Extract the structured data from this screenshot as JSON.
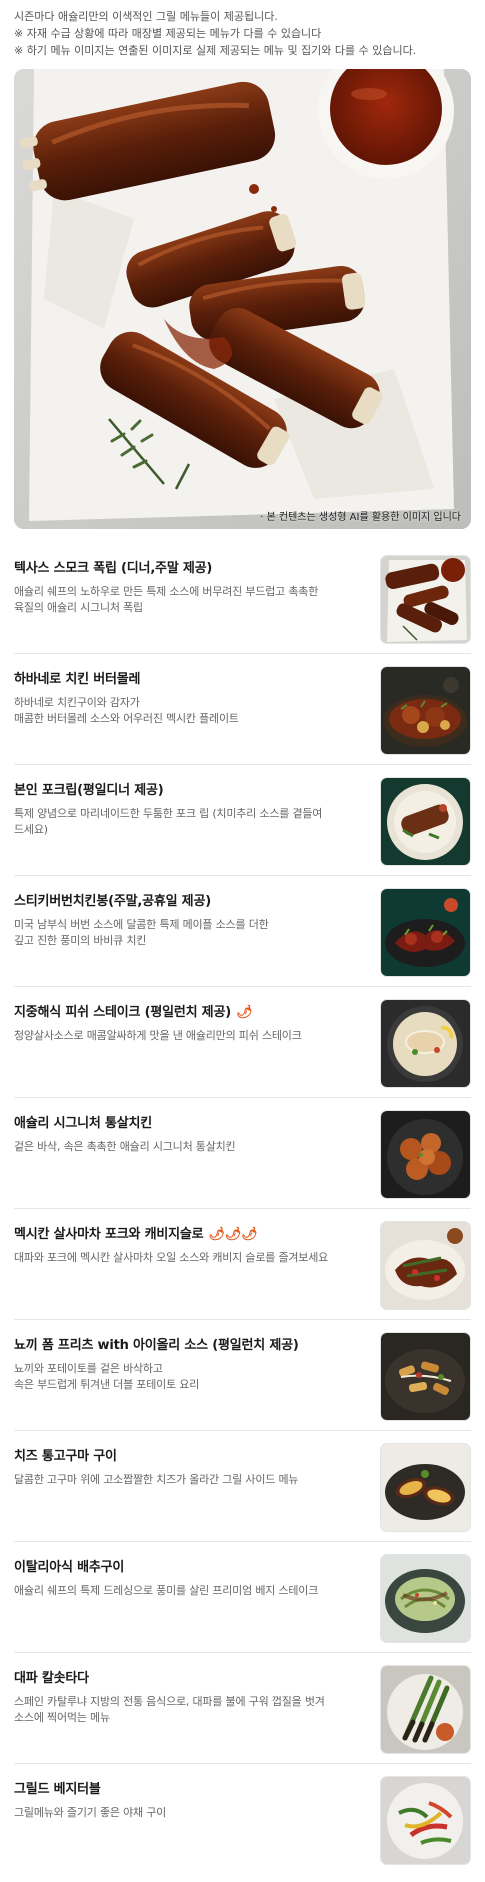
{
  "notices": [
    "시즌마다 애슐리만의 이색적인 그릴 메뉴들이 제공됩니다.",
    "※ 자재 수급 상황에 따라 매장별 제공되는 메뉴가 다를 수 있습니다",
    "※ 하기 메뉴 이미지는 연출된 이미지로 실제 제공되는 메뉴 및 집기와 다를 수 있습니다."
  ],
  "hero": {
    "caption": "· 본 컨텐츠는 생성형 AI를 활용한 이미지 입니다"
  },
  "menu": [
    {
      "title": "텍사스 스모크 폭립 (디너,주말 제공)",
      "desc": "애슐리 쉐프의 노하우로 만든 특제 소스에 버무려진 부드럽고 촉촉한\n육질의 애슐리 시그니처 폭립",
      "spice": 0,
      "thumb_icon": "ribs-thumbnail"
    },
    {
      "title": "하바네로 치킨 버터몰레",
      "desc": "하바네로 치킨구이와 감자가\n매콤한 버터몰레 소스와 어우러진 멕시칸 플레이트",
      "spice": 0,
      "thumb_icon": "chicken-butter-mole-thumbnail"
    },
    {
      "title": "본인 포크립(평일디너 제공)",
      "desc": "특제 양념으로 마리네이드한 두툼한 포크 립 (치미추리 소스를 곁들여\n드세요)",
      "spice": 0,
      "thumb_icon": "pork-rib-thumbnail"
    },
    {
      "title": "스티키버번치킨봉(주말,공휴일 제공)",
      "desc": "미국 남부식 버번 소스에 달콤한 특제 메이플 소스를 더한\n깊고 진한 풍미의 바비큐 치킨",
      "spice": 0,
      "thumb_icon": "bourbon-chicken-thumbnail"
    },
    {
      "title": "지중해식 피쉬 스테이크 (평일런치 제공)",
      "desc": "청양살사소스로 매콤알싸하게 맛을 낸 애슐리만의 피쉬 스테이크",
      "spice": 1,
      "spice_glyph": "🌶",
      "thumb_icon": "fish-steak-thumbnail"
    },
    {
      "title": "애슐리 시그니처 통살치킨",
      "desc": "겉은 바삭, 속은 촉촉한 애슐리 시그니처 통살치킨",
      "spice": 0,
      "thumb_icon": "fried-chicken-thumbnail"
    },
    {
      "title": "멕시칸 살사마차 포크와 캐비지슬로",
      "desc": "대파와 포크에 멕시칸 살사마차 오일 소스와 캐비지 슬로를 즐겨보세요",
      "spice": 3,
      "spice_glyph": "🌶🌶🌶",
      "thumb_icon": "salsa-pork-thumbnail"
    },
    {
      "title": "뇨끼 폼 프리츠 with 아이올리 소스 (평일런치 제공)",
      "desc": "뇨끼와 포테이토를 겉은 바삭하고\n속은 부드럽게 튀겨낸 더블 포테이토 요리",
      "spice": 0,
      "thumb_icon": "gnocchi-fries-thumbnail"
    },
    {
      "title": "치즈 통고구마 구이",
      "desc": "달콤한 고구마 위에 고소짭짤한 치즈가 올라간 그릴 사이드 메뉴",
      "spice": 0,
      "thumb_icon": "sweet-potato-thumbnail"
    },
    {
      "title": "이탈리아식 배추구이",
      "desc": "애슐리 쉐프의 특제 드레싱으로 풍미를 살린 프리미엄 베지 스테이크",
      "spice": 0,
      "thumb_icon": "cabbage-steak-thumbnail"
    },
    {
      "title": "대파 칼솟타다",
      "desc": "스페인 카탈루냐 지방의 전통 음식으로, 대파를 불에 구워 껍질을 벗겨\n소스에 찍어먹는 메뉴",
      "spice": 0,
      "thumb_icon": "calcotada-thumbnail"
    },
    {
      "title": "그릴드 베지터블",
      "desc": "그릴메뉴와 즐기기 좋은 야채 구이",
      "spice": 0,
      "thumb_icon": "grilled-vegetable-thumbnail"
    }
  ],
  "colors": {
    "title": "#1a1a1a",
    "desc": "#666666",
    "divider": "#e6e6e6",
    "pepper": "#e25a1c"
  }
}
